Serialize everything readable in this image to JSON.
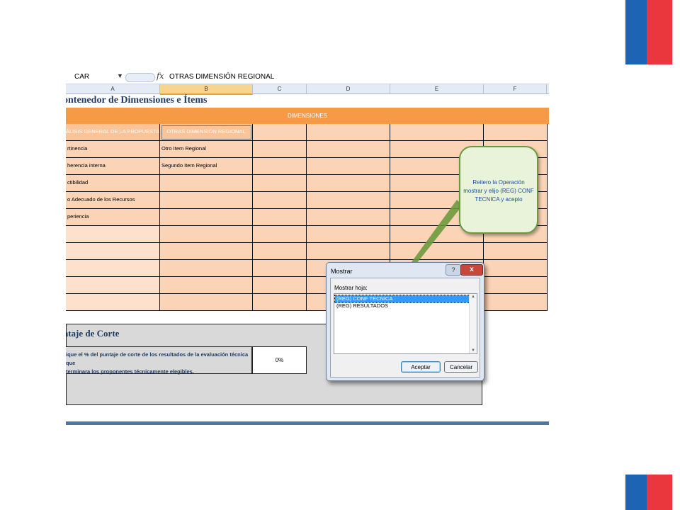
{
  "formula_bar": {
    "name_box": "CAR",
    "fx_label": "fx",
    "formula": "OTRAS DIMENSIÓN REGIONAL"
  },
  "columns": [
    "A",
    "B",
    "C",
    "D",
    "E",
    "F"
  ],
  "sheet_title": "ontenedor de Dimensiones e Ítems",
  "dimensions_header": "DIMENSIONES",
  "table_headers": {
    "a": "ÁLISIS GENERAL DE LA PROPUESTA",
    "b": "OTRAS DIMENSIÓN REGIONAL"
  },
  "rows": [
    {
      "a": "rtinencia",
      "b": "Otro Item Regional"
    },
    {
      "a": "herencia interna",
      "b": "Segundo Item Regional"
    },
    {
      "a": "ctibilidad",
      "b": ""
    },
    {
      "a": "o Adecuado de los Recursos",
      "b": ""
    },
    {
      "a": "periencia",
      "b": ""
    }
  ],
  "corte": {
    "title": "ntaje de Corte",
    "desc_line1": "ique el % del puntaje de corte de los resultados de la evaluación técnica que",
    "desc_line2": "terminara los proponentes técnicamente elegibles.",
    "value": "0%"
  },
  "callout": {
    "text": "Reitero la Operación mostrar y elijo (REG) CONF TECNICA y acepto"
  },
  "dialog": {
    "title": "Mostrar",
    "help": "?",
    "close": "x",
    "label": "Mostrar hoja:",
    "items": [
      "(REG) CONF TECNICA",
      "(REG) RESULTADOS"
    ],
    "ok_label": "Aceptar",
    "cancel_label": "Cancelar"
  },
  "colors": {
    "orange_band": "#f79a46",
    "header_peach": "#f9c49a",
    "flag_blue": "#1e64b4",
    "flag_red": "#e9373d"
  }
}
